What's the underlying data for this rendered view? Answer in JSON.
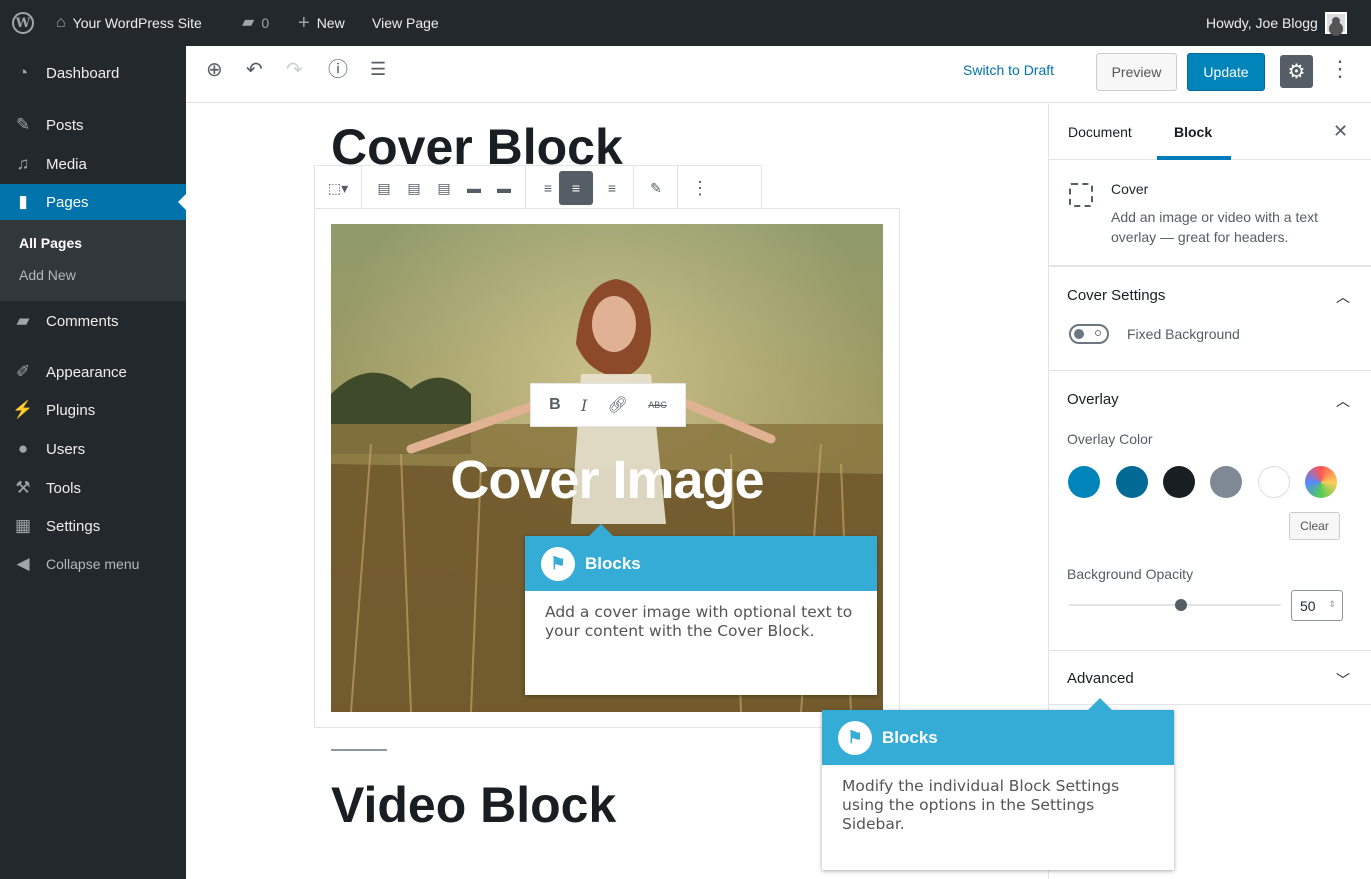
{
  "adminbar": {
    "site_name": "Your WordPress Site",
    "comments_count": "0",
    "new_label": "New",
    "view_label": "View Page",
    "greeting": "Howdy, Joe Blogg"
  },
  "sidebar": {
    "items": [
      {
        "label": "Dashboard",
        "icon": "dashboard-icon"
      },
      {
        "label": "Posts",
        "icon": "pin-icon"
      },
      {
        "label": "Media",
        "icon": "media-icon"
      },
      {
        "label": "Pages",
        "icon": "page-icon"
      },
      {
        "label": "Comments",
        "icon": "comment-icon"
      },
      {
        "label": "Appearance",
        "icon": "brush-icon"
      },
      {
        "label": "Plugins",
        "icon": "plug-icon"
      },
      {
        "label": "Users",
        "icon": "users-icon"
      },
      {
        "label": "Tools",
        "icon": "wrench-icon"
      },
      {
        "label": "Settings",
        "icon": "settings-icon"
      },
      {
        "label": "Collapse menu",
        "icon": "collapse-icon"
      }
    ],
    "submenu": [
      "All Pages",
      "Add New"
    ]
  },
  "header": {
    "switch_draft": "Switch to Draft",
    "preview": "Preview",
    "update": "Update"
  },
  "content": {
    "cover_title": "Cover Block",
    "cover_text": "Cover Image",
    "video_title": "Video Block"
  },
  "format_toolbar": {
    "bold": "B",
    "italic": "I",
    "strike": "ABC"
  },
  "tooltips": [
    {
      "title": "Blocks",
      "body": "Add a cover image with optional text to your content with the Cover Block."
    },
    {
      "title": "Blocks",
      "body": "Modify the individual Block Settings using the options in the Settings Sidebar."
    }
  ],
  "settings": {
    "tabs": [
      "Document",
      "Block"
    ],
    "block_name": "Cover",
    "block_desc": "Add an image or video with a text overlay — great for headers.",
    "cover_settings": "Cover Settings",
    "fixed_background": "Fixed Background",
    "overlay": "Overlay",
    "overlay_color": "Overlay Color",
    "clear": "Clear",
    "background_opacity": "Background Opacity",
    "opacity_value": "50",
    "opacity_fraction": 0.5,
    "advanced": "Advanced"
  },
  "colors": {
    "accent": "#0085ba",
    "swatches": [
      "#0085ba",
      "#006a95",
      "#191e23",
      "#7e8993",
      "#ffffff",
      "gradient"
    ]
  }
}
